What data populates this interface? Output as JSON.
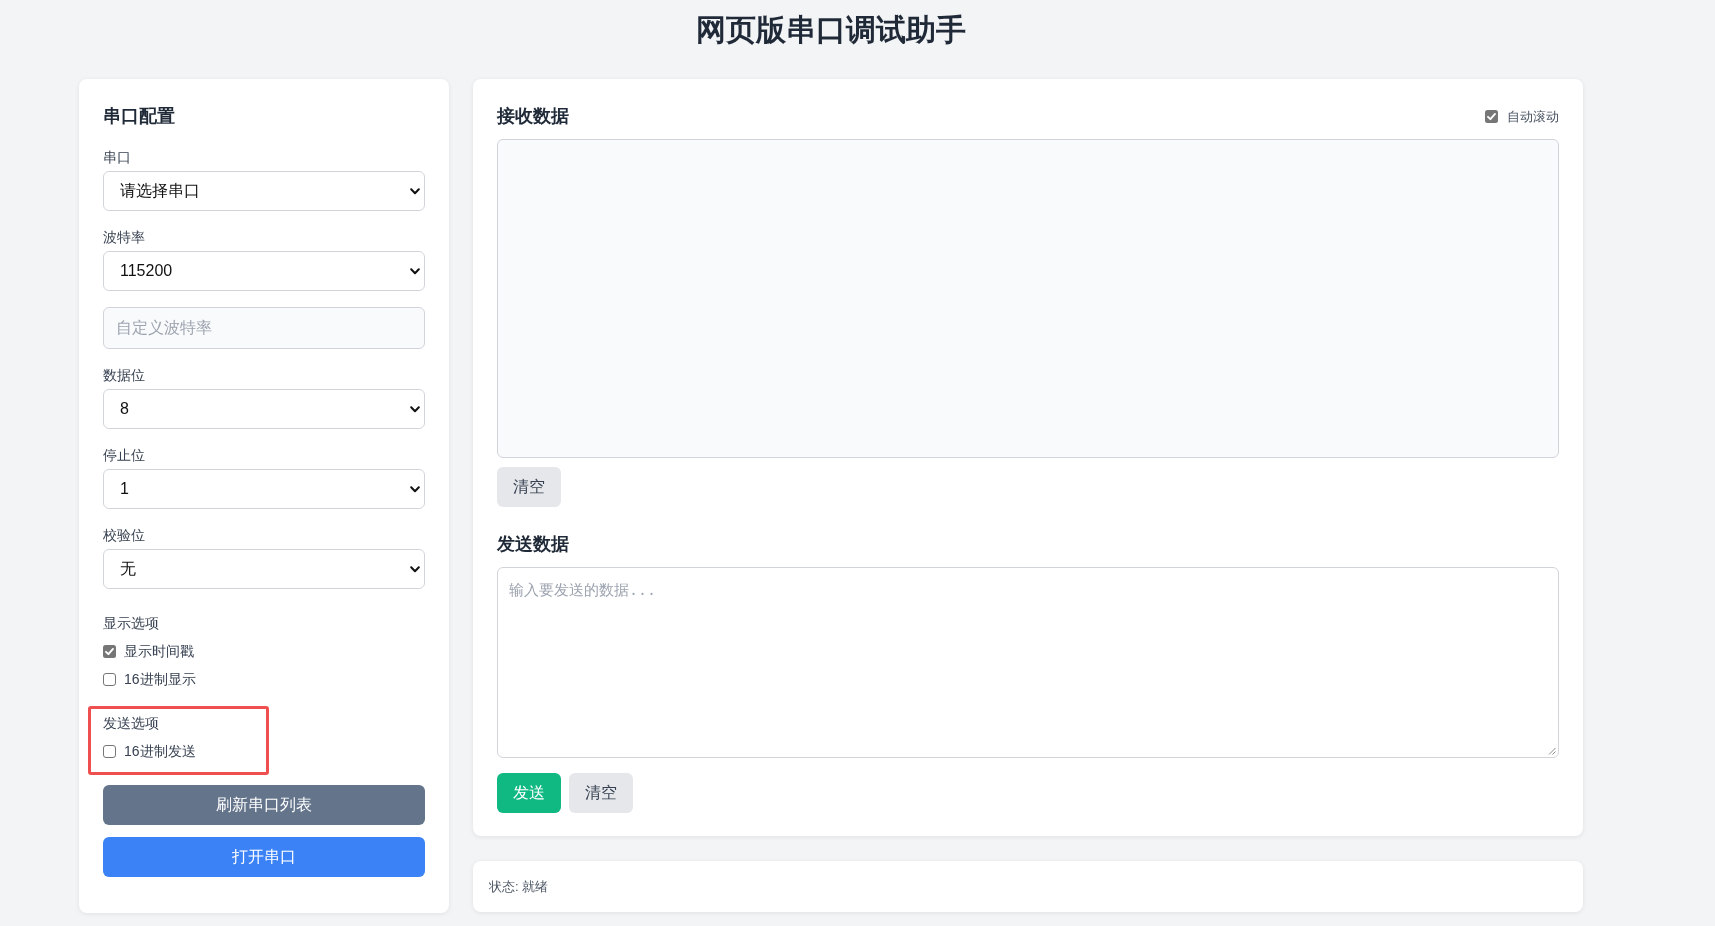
{
  "title": "网页版串口调试助手",
  "config_panel": {
    "heading": "串口配置",
    "fields": [
      {
        "kind": "select",
        "label": "串口",
        "value": "请选择串口"
      },
      {
        "kind": "select",
        "label": "波特率",
        "value": "115200"
      },
      {
        "kind": "input",
        "placeholder": "自定义波特率"
      },
      {
        "kind": "select",
        "label": "数据位",
        "value": "8"
      },
      {
        "kind": "select",
        "label": "停止位",
        "value": "1"
      },
      {
        "kind": "select",
        "label": "校验位",
        "value": "无"
      }
    ],
    "option_groups": [
      {
        "label": "显示选项",
        "highlighted": false,
        "options": [
          {
            "label": "显示时间戳",
            "checked": true
          },
          {
            "label": "16进制显示",
            "checked": false
          }
        ]
      },
      {
        "label": "发送选项",
        "highlighted": true,
        "options": [
          {
            "label": "16进制发送",
            "checked": false
          }
        ]
      }
    ],
    "buttons": [
      {
        "label": "刷新串口列表",
        "kind": "secondary"
      },
      {
        "label": "打开串口",
        "kind": "primary"
      }
    ]
  },
  "receive": {
    "heading": "接收数据",
    "auto_scroll": {
      "label": "自动滚动",
      "checked": true
    },
    "buttons": [
      {
        "label": "清空",
        "kind": "neutral"
      }
    ]
  },
  "send": {
    "heading": "发送数据",
    "placeholder": "输入要发送的数据...",
    "buttons": [
      {
        "label": "发送",
        "kind": "success"
      },
      {
        "label": "清空",
        "kind": "neutral"
      }
    ]
  },
  "status_bar": {
    "text": "状态: 就绪"
  }
}
